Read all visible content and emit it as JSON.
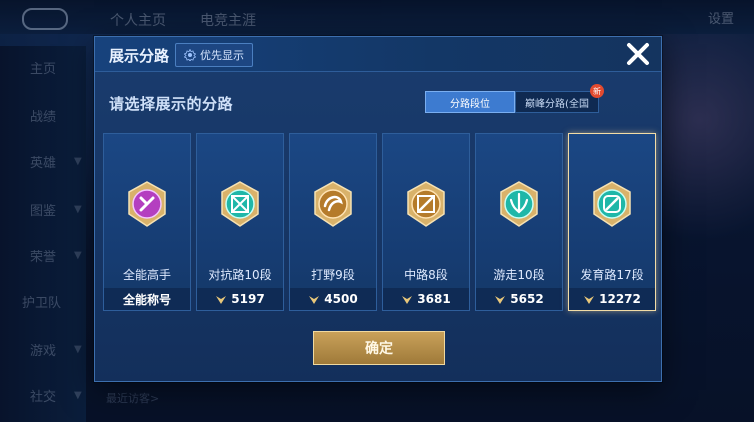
{
  "background": {
    "top_tabs": [
      "个人主页",
      "电竞主涯"
    ],
    "settings_label": "设置",
    "side_nav": [
      "主页",
      "战绩",
      "英雄",
      "图鉴",
      "荣誉",
      "护卫队",
      "游戏",
      "社交"
    ],
    "bottom_text": "最近访客>"
  },
  "modal": {
    "title": "展示分路",
    "priority_button": "优先显示",
    "subtitle": "请选择展示的分路",
    "segment": {
      "active": "分路段位",
      "inactive": "巅峰分路(全国",
      "badge": "新"
    },
    "cards": [
      {
        "label": "全能高手",
        "footer": "全能称号",
        "show_icon": false,
        "emblem": "all-round",
        "color": "#b43fc0",
        "selected": false
      },
      {
        "label": "对抗路10段",
        "footer": "5197",
        "show_icon": true,
        "emblem": "clash-lane",
        "color": "#1fb7a8",
        "selected": false
      },
      {
        "label": "打野9段",
        "footer": "4500",
        "show_icon": true,
        "emblem": "jungle",
        "color": "#b57b2a",
        "selected": false
      },
      {
        "label": "中路8段",
        "footer": "3681",
        "show_icon": true,
        "emblem": "mid-lane",
        "color": "#b57b2a",
        "selected": false
      },
      {
        "label": "游走10段",
        "footer": "5652",
        "show_icon": true,
        "emblem": "roam",
        "color": "#1fb7a8",
        "selected": false
      },
      {
        "label": "发育路17段",
        "footer": "12272",
        "show_icon": true,
        "emblem": "farm-lane",
        "color": "#1fb7a8",
        "selected": true
      }
    ],
    "confirm_label": "确定"
  },
  "colors": {
    "accent_gold": "#c9a15a",
    "accent_blue": "#3d7bd0"
  }
}
